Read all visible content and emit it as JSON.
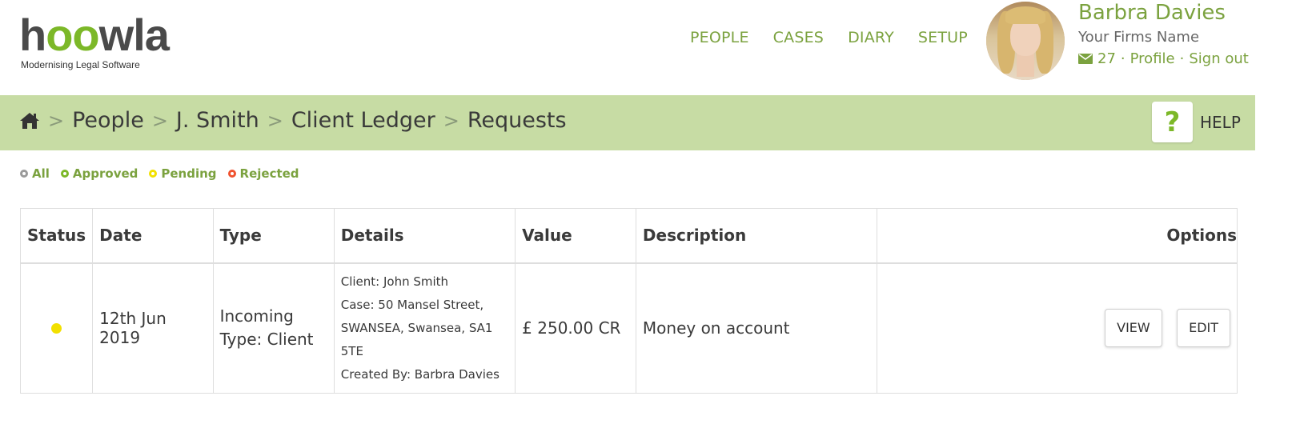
{
  "brand": {
    "logo_text_pre": "h",
    "logo_text_oo": "oo",
    "logo_text_post": "wla",
    "tagline": "Modernising Legal Software",
    "accent_color": "#7cb828"
  },
  "nav": {
    "items": [
      {
        "label": "PEOPLE"
      },
      {
        "label": "CASES"
      },
      {
        "label": "DIARY"
      },
      {
        "label": "SETUP"
      }
    ]
  },
  "user": {
    "name": "Barbra Davies",
    "firm": "Your Firms Name",
    "message_count": "27",
    "separator": "·",
    "profile_label": "Profile",
    "signout_label": "Sign out",
    "icon": "envelope-icon"
  },
  "breadcrumb": {
    "home_icon": "home-icon",
    "separator": ">",
    "items": [
      {
        "label": "People"
      },
      {
        "label": "J. Smith"
      },
      {
        "label": "Client Ledger"
      },
      {
        "label": "Requests"
      }
    ],
    "help_symbol": "?",
    "help_label": "HELP",
    "bar_color": "#c7dca4"
  },
  "filters": [
    {
      "label": "All",
      "color": "#9a9a9a"
    },
    {
      "label": "Approved",
      "color": "#7cb828"
    },
    {
      "label": "Pending",
      "color": "#f2e000"
    },
    {
      "label": "Rejected",
      "color": "#f0522f"
    }
  ],
  "table": {
    "headers": {
      "status": "Status",
      "date": "Date",
      "type": "Type",
      "details": "Details",
      "value": "Value",
      "description": "Description",
      "options": "Options"
    },
    "rows": [
      {
        "status": "pending",
        "status_color": "#f2e000",
        "date": "12th Jun 2019",
        "type_line1": "Incoming",
        "type_line2": "Type: Client",
        "details": {
          "client": "Client: John Smith",
          "case_line1": "Case: 50 Mansel Street,",
          "case_line2": "SWANSEA, Swansea, SA1",
          "case_line3": "5TE",
          "created_by": "Created By: Barbra Davies"
        },
        "value": "£ 250.00 CR",
        "description": "Money on account",
        "view_label": "VIEW",
        "edit_label": "EDIT"
      }
    ]
  }
}
